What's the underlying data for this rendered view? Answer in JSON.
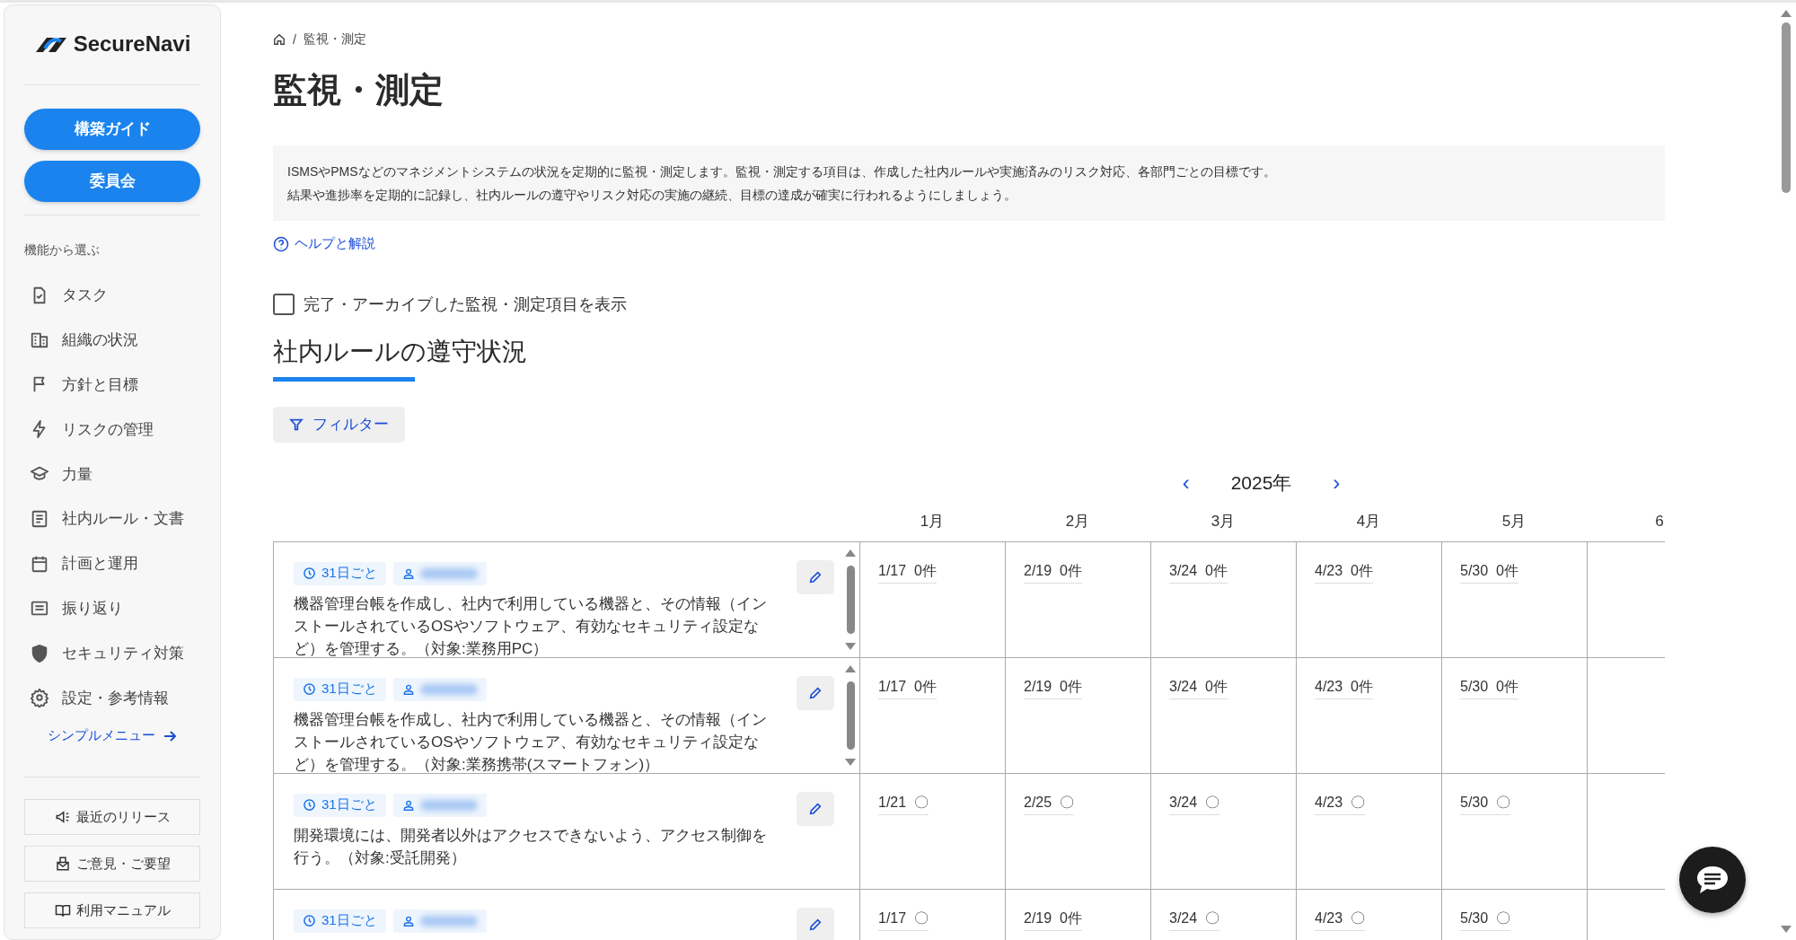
{
  "sidebar": {
    "logo": "SecureNavi",
    "buttons": [
      "構築ガイド",
      "委員会"
    ],
    "section_label": "機能から選ぶ",
    "items": [
      {
        "label": "タスク"
      },
      {
        "label": "組織の状況"
      },
      {
        "label": "方針と目標"
      },
      {
        "label": "リスクの管理"
      },
      {
        "label": "力量"
      },
      {
        "label": "社内ルール・文書"
      },
      {
        "label": "計画と運用"
      },
      {
        "label": "振り返り"
      },
      {
        "label": "セキュリティ対策"
      },
      {
        "label": "設定・参考情報"
      }
    ],
    "simple_menu": "シンプルメニュー",
    "footer_buttons": [
      "最近のリリース",
      "ご意見・ご要望",
      "利用マニュアル"
    ]
  },
  "breadcrumb_separator": "/",
  "breadcrumb": "監視・測定",
  "title": "監視・測定",
  "description": [
    "ISMSやPMSなどのマネジメントシステムの状況を定期的に監視・測定します。監視・測定する項目は、作成した社内ルールや実施済みのリスク対応、各部門ごとの目標です。",
    "結果や進捗率を定期的に記録し、社内ルールの遵守やリスク対応の実施の継続、目標の達成が確実に行われるようにしましょう。"
  ],
  "help_link": "ヘルプと解説",
  "show_archived": {
    "label": "完了・アーカイブした監視・測定項目を表示",
    "checked": false
  },
  "tabs": [
    {
      "label": "社内ルールの遵守状況",
      "selected": true
    }
  ],
  "filter_button": "フィルター",
  "calendar": {
    "prev": "‹",
    "year": "2025年",
    "next": "›",
    "months": [
      "1月",
      "2月",
      "3月",
      "4月",
      "5月",
      "6"
    ]
  },
  "rows": [
    {
      "frequency": "31日ごと",
      "scroll": true,
      "description": "機器管理台帳を作成し、社内で利用している機器と、その情報（インストールされているOSやソフトウェア、有効なセキュリティ設定など）を管理する。（対象:業務用PC）",
      "cells": [
        {
          "date": "1/17",
          "result": "0件"
        },
        {
          "date": "2/19",
          "result": "0件"
        },
        {
          "date": "3/24",
          "result": "0件"
        },
        {
          "date": "4/23",
          "result": "0件"
        },
        {
          "date": "5/30",
          "result": "0件"
        }
      ]
    },
    {
      "frequency": "31日ごと",
      "scroll": true,
      "description": "機器管理台帳を作成し、社内で利用している機器と、その情報（インストールされているOSやソフトウェア、有効なセキュリティ設定など）を管理する。（対象:業務携帯(スマートフォン)）",
      "cells": [
        {
          "date": "1/17",
          "result": "0件"
        },
        {
          "date": "2/19",
          "result": "0件"
        },
        {
          "date": "3/24",
          "result": "0件"
        },
        {
          "date": "4/23",
          "result": "0件"
        },
        {
          "date": "5/30",
          "result": "0件"
        }
      ]
    },
    {
      "frequency": "31日ごと",
      "scroll": false,
      "description": "開発環境には、開発者以外はアクセスできないよう、アクセス制御を行う。（対象:受託開発）",
      "cells": [
        {
          "date": "1/21",
          "result": "〇"
        },
        {
          "date": "2/25",
          "result": "〇"
        },
        {
          "date": "3/24",
          "result": "〇"
        },
        {
          "date": "4/23",
          "result": "〇"
        },
        {
          "date": "5/30",
          "result": "〇"
        }
      ]
    },
    {
      "frequency": "31日ごと",
      "scroll": false,
      "cells": [
        {
          "date": "1/17",
          "result": "〇"
        },
        {
          "date": "2/19",
          "result": "0件"
        },
        {
          "date": "3/24",
          "result": "〇"
        },
        {
          "date": "4/23",
          "result": "〇"
        },
        {
          "date": "5/30",
          "result": "〇"
        }
      ]
    }
  ]
}
